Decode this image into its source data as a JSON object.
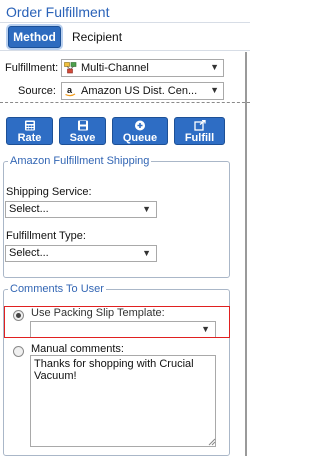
{
  "header": {
    "title": "Order Fulfillment"
  },
  "tabs": [
    {
      "label": "Method",
      "active": true
    },
    {
      "label": "Recipient",
      "active": false
    }
  ],
  "fulfillment": {
    "label": "Fulfillment:",
    "value": "Multi-Channel"
  },
  "source": {
    "label": "Source:",
    "value": "Amazon US Dist. Cen..."
  },
  "toolbar": {
    "buttons": [
      {
        "label": "Rate",
        "icon": "calculator-icon"
      },
      {
        "label": "Save",
        "icon": "save-icon"
      },
      {
        "label": "Queue",
        "icon": "add-circle-icon"
      },
      {
        "label": "Fulfill",
        "icon": "external-link-icon"
      }
    ]
  },
  "amazon_shipping": {
    "legend": "Amazon Fulfillment Shipping",
    "shipping_service": {
      "label": "Shipping Service:",
      "value": "Select..."
    },
    "fulfillment_type": {
      "label": "Fulfillment Type:",
      "value": "Select..."
    }
  },
  "comments": {
    "legend": "Comments To User",
    "packing_slip": {
      "label": "Use Packing Slip Template:",
      "value": "",
      "selected": true
    },
    "manual": {
      "label": "Manual comments:",
      "value": "Thanks for shopping with Crucial Vacuum!",
      "selected": false
    }
  },
  "colors": {
    "accent": "#2d6bbf",
    "title": "#2a62b8",
    "highlight": "#e02020"
  }
}
